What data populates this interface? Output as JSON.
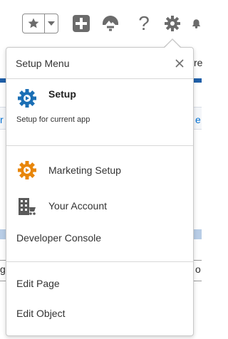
{
  "colors": {
    "accent_blue": "#0070d2",
    "setup_gear": "#1b6fb5",
    "marketing_orange": "#e8860a",
    "icon_gray": "#6b6b6b"
  },
  "header": {
    "icons": [
      "star-icon",
      "chevron-down-icon",
      "plus-icon",
      "trailhead-icon",
      "help-icon",
      "gear-icon",
      "bell-icon"
    ],
    "help_glyph": "?"
  },
  "background": {
    "frag_re": "re",
    "frag_r": "r",
    "frag_e": "e",
    "frag_g": "g",
    "frag_o": "o"
  },
  "menu": {
    "title": "Setup Menu",
    "close_glyph": "×",
    "setup": {
      "label": "Setup",
      "subtitle": "Setup for current app"
    },
    "items": [
      {
        "label": "Marketing Setup",
        "icon": "marketing-gear-icon"
      },
      {
        "label": "Your Account",
        "icon": "account-building-icon"
      },
      {
        "label": "Developer Console"
      },
      {
        "label": "Edit Page"
      },
      {
        "label": "Edit Object"
      }
    ]
  }
}
